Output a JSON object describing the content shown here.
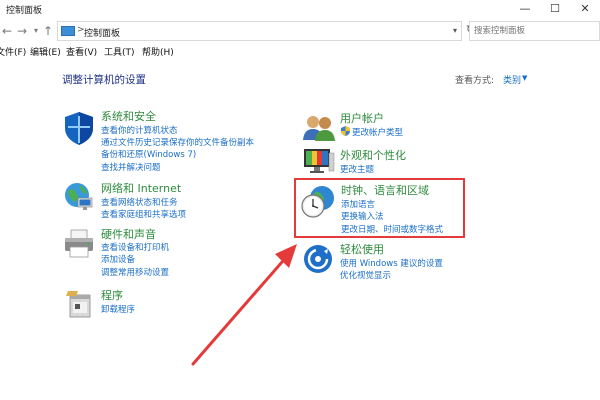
{
  "window": {
    "title": "控制面板",
    "minimize": "—",
    "maximize": "☐",
    "close": "✕"
  },
  "address": {
    "back": "←",
    "forward": "→",
    "up": "↑",
    "crumb": "控制面板",
    "separator": ">",
    "refresh": "↻",
    "search_placeholder": "搜索控制面板"
  },
  "menu": [
    {
      "label": "文件(F)"
    },
    {
      "label": "编辑(E)"
    },
    {
      "label": "查看(V)"
    },
    {
      "label": "工具(T)"
    },
    {
      "label": "帮助(H)"
    }
  ],
  "header": {
    "title": "调整计算机的设置",
    "view_by_label": "查看方式:",
    "view_by_value": "类别"
  },
  "left_categories": [
    {
      "title": "系统和安全",
      "icon": "shield-icon",
      "links": [
        "查看你的计算机状态",
        "通过文件历史记录保存你的文件备份副本",
        "备份和还原(Windows 7)",
        "查找并解决问题"
      ]
    },
    {
      "title": "网络和 Internet",
      "icon": "network-globe-icon",
      "links": [
        "查看网络状态和任务",
        "查看家庭组和共享选项"
      ]
    },
    {
      "title": "硬件和声音",
      "icon": "printer-icon",
      "links": [
        "查看设备和打印机",
        "添加设备",
        "调整常用移动设置"
      ]
    },
    {
      "title": "程序",
      "icon": "programs-icon",
      "links": [
        "卸载程序"
      ]
    }
  ],
  "right_categories": [
    {
      "title": "用户帐户",
      "icon": "users-icon",
      "links": [
        "更改帐户类型"
      ]
    },
    {
      "title": "外观和个性化",
      "icon": "monitor-icon",
      "links": [
        "更改主题"
      ]
    },
    {
      "title": "时钟、语言和区域",
      "icon": "clock-globe-icon",
      "links": [
        "添加语言",
        "更换输入法",
        "更改日期、时间或数字格式"
      ]
    },
    {
      "title": "轻松使用",
      "icon": "accessibility-icon",
      "links": [
        "使用 Windows 建议的设置",
        "优化视觉显示"
      ]
    }
  ],
  "colors": {
    "category_title": "#2e8b3e",
    "link": "#1a6ec8",
    "heading": "#1e3287",
    "highlight": "#e53a3a"
  }
}
